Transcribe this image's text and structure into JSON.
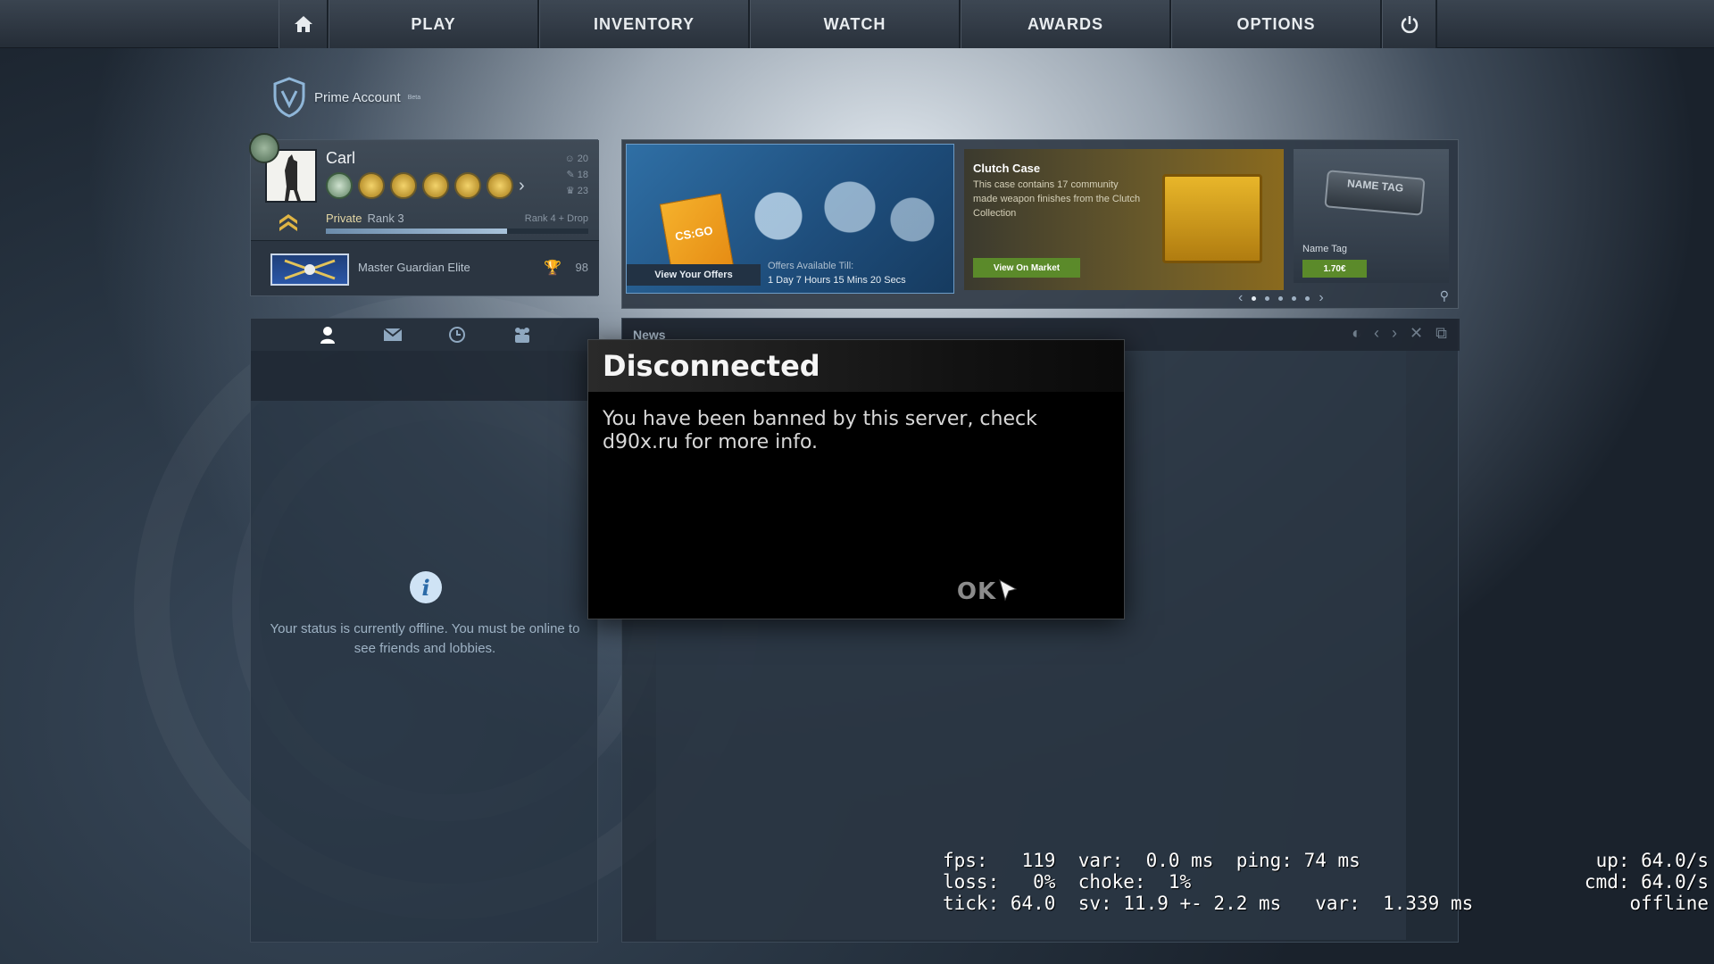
{
  "nav": {
    "home_icon": "home-icon",
    "items": [
      "PLAY",
      "INVENTORY",
      "WATCH",
      "AWARDS",
      "OPTIONS"
    ],
    "power_icon": "power-icon"
  },
  "prime": {
    "label": "Prime Account",
    "beta": "Beta"
  },
  "profile": {
    "name": "Carl",
    "stats": [
      "20",
      "18",
      "23"
    ],
    "rank_title": "Private",
    "rank_number": "Rank 3",
    "rank_drop": "Rank 4 + Drop",
    "xp_progress": 0.69,
    "skill_group": "Master Guardian Elite",
    "wins": "98"
  },
  "store": {
    "offer_button": "View Your Offers",
    "offer_till_label": "Offers Available Till:",
    "offer_till_time": "1 Day  7 Hours  15 Mins  20 Secs",
    "offer_logo": "CS:GO",
    "clutch_title": "Clutch Case",
    "clutch_desc": "This case contains 17 community made weapon finishes from the Clutch Collection",
    "market_button": "View On Market",
    "nametag_plate": "NAME TAG",
    "nametag_label": "Name Tag",
    "nametag_price": "1.70€",
    "pages": 5,
    "active_page": 1
  },
  "friends": {
    "tabs": [
      "friends-icon",
      "mail-icon",
      "history-icon",
      "lobbies-icon"
    ],
    "offline_message": "Your status is currently offline.  You must be online to see friends and lobbies."
  },
  "news": {
    "title": "News"
  },
  "dialog": {
    "title": "Disconnected",
    "message": "You have been banned by this server, check d90x.ru for more info.",
    "ok_label": "OK"
  },
  "netgraph": {
    "line1": "fps:   119  var:  0.0 ms  ping: 74 ms",
    "line2": "loss:   0%  choke:  1%",
    "line3": "tick: 64.0  sv: 11.9 +- 2.2 ms   var:  1.339 ms",
    "right1": "up: 64.0/s",
    "right2": "cmd: 64.0/s",
    "right3": "offline"
  }
}
